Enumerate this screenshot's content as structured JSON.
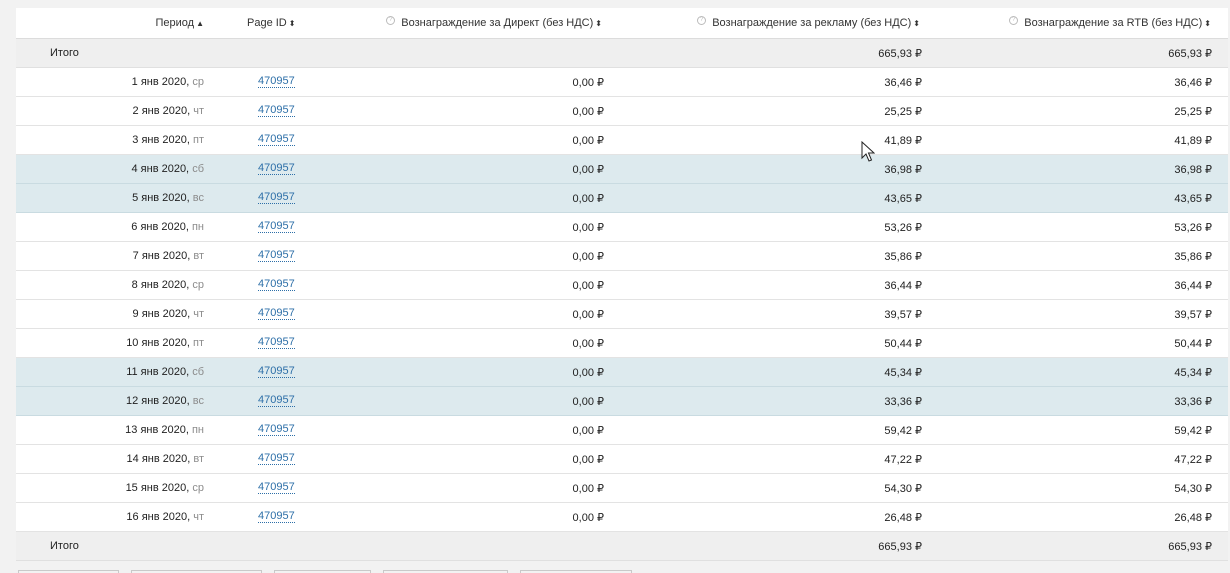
{
  "header": {
    "period": "Период",
    "page_id": "Page ID",
    "direct": "Вознаграждение за Директ (без НДС)",
    "ads": "Вознаграждение за рекламу (без НДС)",
    "rtb": "Вознаграждение за RTB (без НДС)",
    "period_sort": "▲",
    "sort_both": "⬍"
  },
  "total_top": {
    "label": "Итого",
    "ads": "665,93 ₽",
    "rtb": "665,93 ₽"
  },
  "rows": [
    {
      "date": "1 янв 2020,",
      "day": "ср",
      "page_id": "470957",
      "direct": "0,00 ₽",
      "ads": "36,46 ₽",
      "rtb": "36,46 ₽",
      "weekend": false
    },
    {
      "date": "2 янв 2020,",
      "day": "чт",
      "page_id": "470957",
      "direct": "0,00 ₽",
      "ads": "25,25 ₽",
      "rtb": "25,25 ₽",
      "weekend": false
    },
    {
      "date": "3 янв 2020,",
      "day": "пт",
      "page_id": "470957",
      "direct": "0,00 ₽",
      "ads": "41,89 ₽",
      "rtb": "41,89 ₽",
      "weekend": false
    },
    {
      "date": "4 янв 2020,",
      "day": "сб",
      "page_id": "470957",
      "direct": "0,00 ₽",
      "ads": "36,98 ₽",
      "rtb": "36,98 ₽",
      "weekend": true
    },
    {
      "date": "5 янв 2020,",
      "day": "вс",
      "page_id": "470957",
      "direct": "0,00 ₽",
      "ads": "43,65 ₽",
      "rtb": "43,65 ₽",
      "weekend": true
    },
    {
      "date": "6 янв 2020,",
      "day": "пн",
      "page_id": "470957",
      "direct": "0,00 ₽",
      "ads": "53,26 ₽",
      "rtb": "53,26 ₽",
      "weekend": false
    },
    {
      "date": "7 янв 2020,",
      "day": "вт",
      "page_id": "470957",
      "direct": "0,00 ₽",
      "ads": "35,86 ₽",
      "rtb": "35,86 ₽",
      "weekend": false
    },
    {
      "date": "8 янв 2020,",
      "day": "ср",
      "page_id": "470957",
      "direct": "0,00 ₽",
      "ads": "36,44 ₽",
      "rtb": "36,44 ₽",
      "weekend": false
    },
    {
      "date": "9 янв 2020,",
      "day": "чт",
      "page_id": "470957",
      "direct": "0,00 ₽",
      "ads": "39,57 ₽",
      "rtb": "39,57 ₽",
      "weekend": false
    },
    {
      "date": "10 янв 2020,",
      "day": "пт",
      "page_id": "470957",
      "direct": "0,00 ₽",
      "ads": "50,44 ₽",
      "rtb": "50,44 ₽",
      "weekend": false
    },
    {
      "date": "11 янв 2020,",
      "day": "сб",
      "page_id": "470957",
      "direct": "0,00 ₽",
      "ads": "45,34 ₽",
      "rtb": "45,34 ₽",
      "weekend": true
    },
    {
      "date": "12 янв 2020,",
      "day": "вс",
      "page_id": "470957",
      "direct": "0,00 ₽",
      "ads": "33,36 ₽",
      "rtb": "33,36 ₽",
      "weekend": true
    },
    {
      "date": "13 янв 2020,",
      "day": "пн",
      "page_id": "470957",
      "direct": "0,00 ₽",
      "ads": "59,42 ₽",
      "rtb": "59,42 ₽",
      "weekend": false
    },
    {
      "date": "14 янв 2020,",
      "day": "вт",
      "page_id": "470957",
      "direct": "0,00 ₽",
      "ads": "47,22 ₽",
      "rtb": "47,22 ₽",
      "weekend": false
    },
    {
      "date": "15 янв 2020,",
      "day": "ср",
      "page_id": "470957",
      "direct": "0,00 ₽",
      "ads": "54,30 ₽",
      "rtb": "54,30 ₽",
      "weekend": false
    },
    {
      "date": "16 янв 2020,",
      "day": "чт",
      "page_id": "470957",
      "direct": "0,00 ₽",
      "ads": "26,48 ₽",
      "rtb": "26,48 ₽",
      "weekend": false
    }
  ],
  "total_bottom": {
    "label": "Итого",
    "ads": "665,93 ₽",
    "rtb": "665,93 ₽"
  },
  "icons": {
    "help": "help-circle-icon",
    "cursor": "mouse-pointer-icon"
  },
  "colors": {
    "link": "#2d6fa8",
    "weekend_row": "#ddeaee",
    "total_row": "#efefef"
  }
}
